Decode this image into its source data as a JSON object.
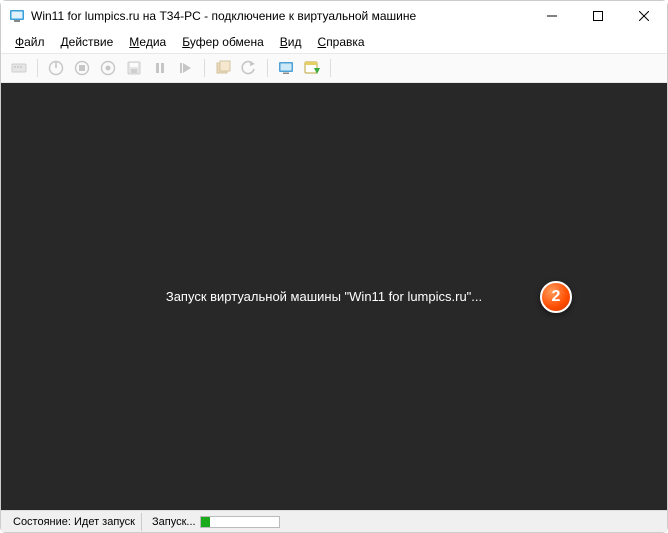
{
  "titlebar": {
    "title": "Win11 for lumpics.ru на T34-PC - подключение к виртуальной машине"
  },
  "menubar": {
    "items": [
      {
        "pre": "",
        "hotkey": "Ф",
        "post": "айл"
      },
      {
        "pre": "",
        "hotkey": "Д",
        "post": "ействие"
      },
      {
        "pre": "",
        "hotkey": "М",
        "post": "едиа"
      },
      {
        "pre": "",
        "hotkey": "Б",
        "post": "уфер обмена"
      },
      {
        "pre": "",
        "hotkey": "В",
        "post": "ид"
      },
      {
        "pre": "",
        "hotkey": "С",
        "post": "правка"
      }
    ]
  },
  "toolbar": {
    "ctrlaltdel": "Ctrl+Alt+Del"
  },
  "viewport": {
    "starting_message": "Запуск виртуальной машины \"Win11 for lumpics.ru\"..."
  },
  "callout": "2",
  "statusbar": {
    "state_label": "Состояние:",
    "state_value": "Идет запуск",
    "phase_label": "Запуск..."
  }
}
